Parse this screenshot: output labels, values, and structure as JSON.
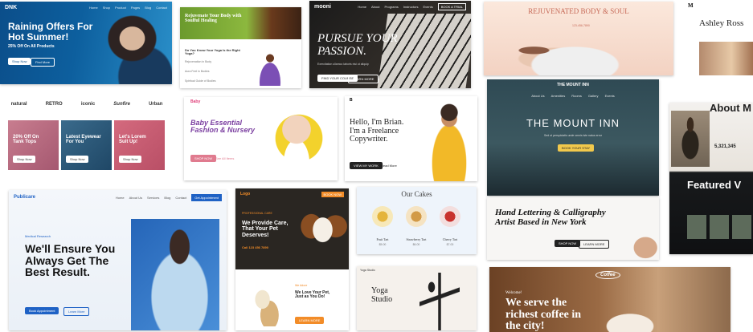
{
  "t1": {
    "logo": "DNK",
    "nav": [
      "Home",
      "Shop",
      "Product",
      "Pages",
      "Blog",
      "Contact"
    ],
    "headline": "Raining Offers For\nHot Summer!",
    "sub": "25% Off On All Products",
    "btn1": "Shop Now",
    "btn2": "Find More"
  },
  "t2": {
    "title": "Rejuvenate Your Body with\nSoulful Healing",
    "post": "Do You Know Your Yoga Is the Right\nYoga?",
    "items": [
      "Rejuvenation in Body",
      "Aura Feel in Bodies",
      "Spiritual Guide of Bodies"
    ]
  },
  "t3": {
    "logo": "mooni",
    "nav": [
      "Home",
      "About",
      "Programs",
      "Instructors",
      "Events"
    ],
    "cta": "BOOK A TRIAL",
    "headline": "PURSUE YOUR\nPASSION.",
    "sub": "Exercitation ullamco laboris nisi ut aliquip",
    "btn1": "FIND YOUR COURSE",
    "btn2": "LEARN MORE"
  },
  "t4": {
    "title": "REJUVENATED BODY & SOUL",
    "phone": "123-456-7890"
  },
  "t5": {
    "logo": "M",
    "name": "Ashley Ross"
  },
  "t6": {
    "brands": [
      "natural",
      "RETRO",
      "iconic",
      "Sunfire",
      "Urban"
    ],
    "promos": [
      {
        "label": "20% Off On\nTank Tops",
        "btn": "Shop Now"
      },
      {
        "label": "Latest Eyewear\nFor You",
        "btn": "Shop Now"
      },
      {
        "label": "Let's Lorem\nSuit Up!",
        "btn": "Shop Now"
      }
    ]
  },
  "t7": {
    "logo": "Baby",
    "headline": "Baby Essential\nFashion & Nursery",
    "btn1": "SHOP NOW",
    "btn2": "See All Items"
  },
  "t8": {
    "logo": "B",
    "headline": "Hello, I'm Brian.\nI'm a Freelance\nCopywriter.",
    "btn1": "VIEW MY WORK",
    "btn2": "Read More"
  },
  "t9": {
    "logo": "THE MOUNT INN",
    "nav": [
      "About Us",
      "Amenities",
      "Rooms",
      "Gallery",
      "Events"
    ],
    "headline": "THE MOUNT INN",
    "sub": "Sed ut perspiciatis unde omnis iste natus error",
    "btn": "BOOK YOUR STAY"
  },
  "t10": {
    "headline": "About M",
    "stats": [
      "5,321,345"
    ],
    "feature": "Featured V"
  },
  "t11": {
    "logo": "Publicare",
    "nav": [
      "Home",
      "About Us",
      "Services",
      "Blog",
      "Contact"
    ],
    "cta": "Get Appointment",
    "tag": "Medical Research",
    "headline": "We'll Ensure You\nAlways Get The\nBest Result.",
    "btn1": "Book Appointment",
    "btn2": "Learn More"
  },
  "t12": {
    "logo": "Logo",
    "cta": "BOOK NOW",
    "tag": "PROFESSIONAL CARE",
    "headline": "We Provide Care,\nThat Your Pet\nDeserves!",
    "phone": "Call 123 456 7890",
    "tag2": "We Adore",
    "head2": "We Love Your Pet,\nJust as You Do!",
    "btn": "LEARN MORE"
  },
  "t13": {
    "title": "Our Cakes",
    "items": [
      {
        "name": "Fruit Tart",
        "price": "$5.00"
      },
      {
        "name": "Strawberry Tart",
        "price": "$6.00"
      },
      {
        "name": "Cherry Tart",
        "price": "$7.00"
      }
    ]
  },
  "t14": {
    "headline": "Hand Lettering & Calligraphy\nArtist Based in New York",
    "btn1": "SHOP NOW",
    "btn2": "LEARN MORE"
  },
  "t15": {
    "logo": "Yoga Studio",
    "headline": "Yoga\nStudio"
  },
  "t16": {
    "logo": "Coffee",
    "tag": "Welcome!",
    "headline": "We serve the\nrichest coffee in\nthe city!"
  },
  "colors": {
    "purple": "#7b3fa0",
    "teal": "#0e7a8a",
    "orange": "#f28c28",
    "blue": "#1f62c5",
    "cream": "#f6e3d3"
  }
}
